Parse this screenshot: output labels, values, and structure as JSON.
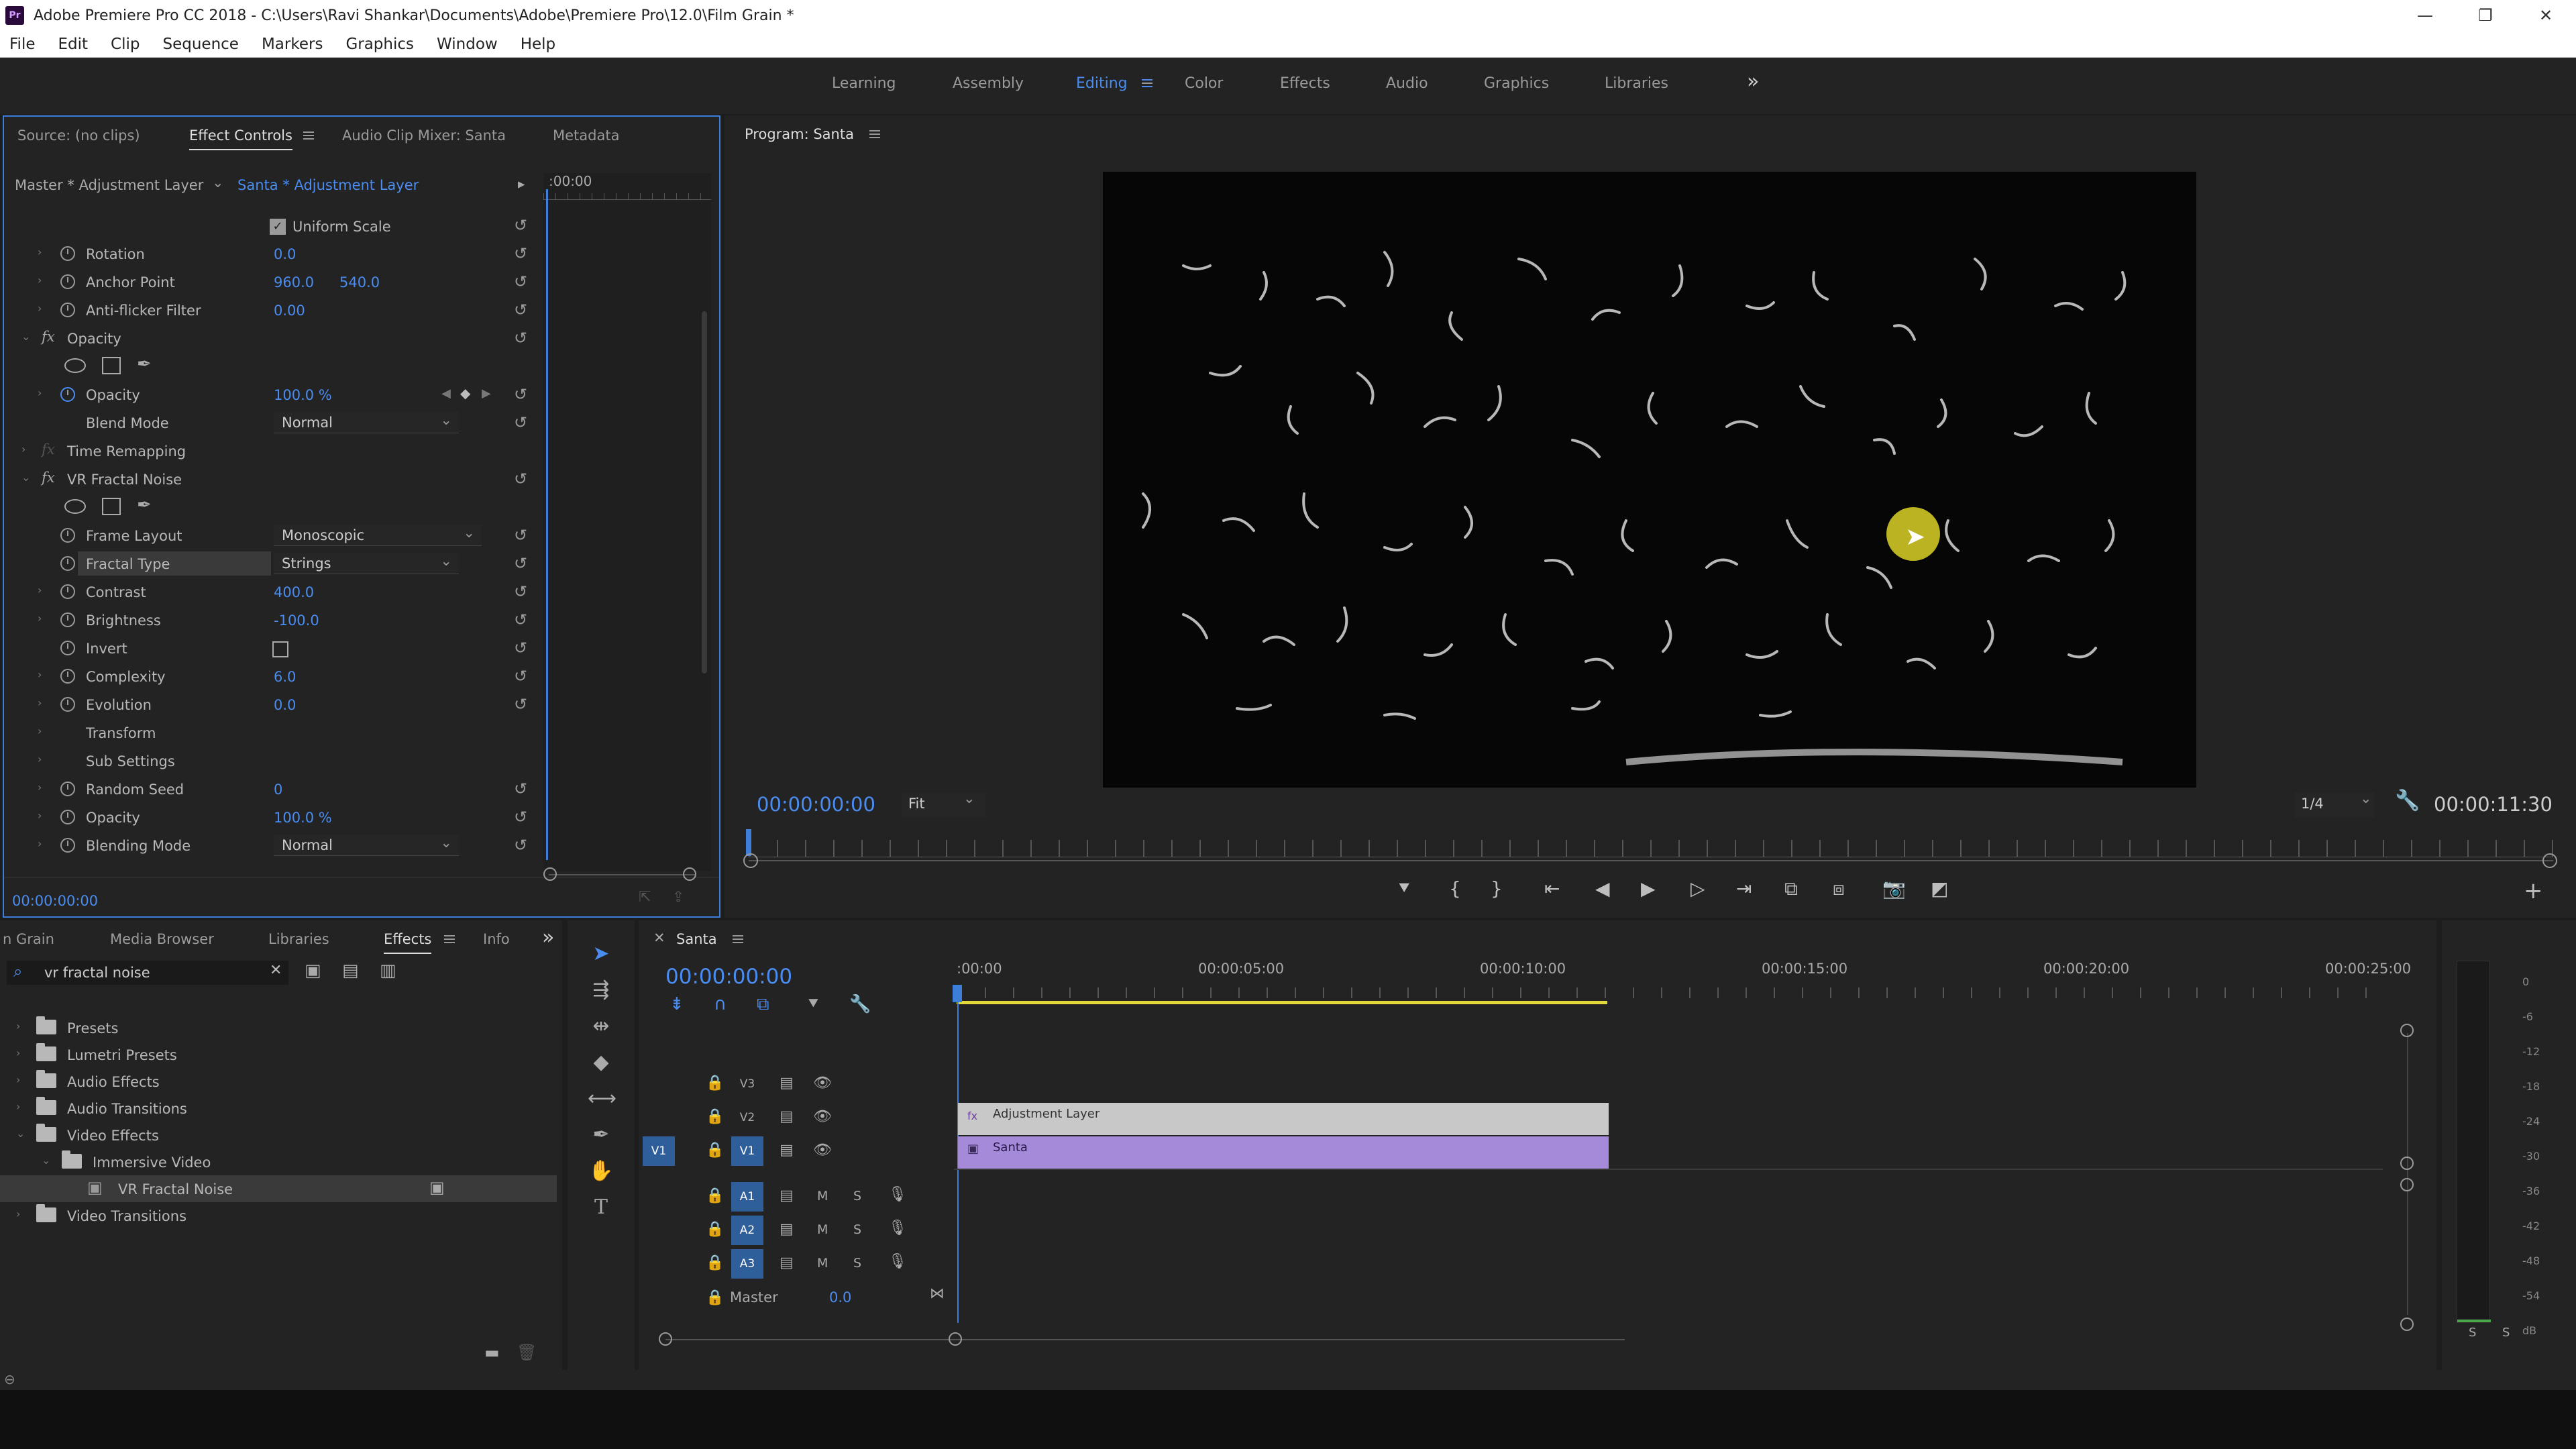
{
  "window": {
    "title": "Adobe Premiere Pro CC 2018 - C:\\Users\\Ravi Shankar\\Documents\\Adobe\\Premiere Pro\\12.0\\Film Grain *",
    "app_badge": "Pr"
  },
  "window_controls": {
    "minimize": "—",
    "restore": "❐",
    "close": "✕"
  },
  "menu": [
    "File",
    "Edit",
    "Clip",
    "Sequence",
    "Markers",
    "Graphics",
    "Window",
    "Help"
  ],
  "workspaces": [
    "Learning",
    "Assembly",
    "Editing",
    "Color",
    "Effects",
    "Audio",
    "Graphics",
    "Libraries"
  ],
  "workspaces_overflow": "»",
  "effect_panel": {
    "tabs": {
      "source": "Source: (no clips)",
      "effect_controls": "Effect Controls",
      "audio_mixer": "Audio Clip Mixer: Santa",
      "metadata": "Metadata"
    },
    "master_label": "Master * Adjustment Layer",
    "clip_label": "Santa * Adjustment Layer",
    "ruler_time": ":00:00",
    "uniform_scale": "Uniform Scale",
    "motion_rows": [
      {
        "label": "Rotation",
        "v1": "0.0"
      },
      {
        "label": "Anchor Point",
        "v1": "960.0",
        "v2": "540.0"
      },
      {
        "label": "Anti-flicker Filter",
        "v1": "0.00"
      }
    ],
    "opacity_header": "Opacity",
    "opacity_value": "100.0 %",
    "opacity_label": "Opacity",
    "blend_mode_label": "Blend Mode",
    "blend_mode_value": "Normal",
    "time_remap": "Time Remapping",
    "vr_header": "VR Fractal Noise",
    "frame_layout_label": "Frame Layout",
    "frame_layout_value": "Monoscopic",
    "fractal_type_label": "Fractal Type",
    "fractal_type_value": "Strings",
    "vr_rows": [
      {
        "label": "Contrast",
        "v1": "400.0"
      },
      {
        "label": "Brightness",
        "v1": "-100.0"
      }
    ],
    "invert_label": "Invert",
    "vr_rows2": [
      {
        "label": "Complexity",
        "v1": "6.0"
      },
      {
        "label": "Evolution",
        "v1": "0.0"
      }
    ],
    "transform": "Transform",
    "sub_settings": "Sub Settings",
    "vr_rows3": [
      {
        "label": "Random Seed",
        "v1": "0"
      },
      {
        "label": "Opacity",
        "v1": "100.0 %"
      }
    ],
    "blending_mode_label": "Blending Mode",
    "blending_mode_value": "Normal",
    "footer_time": "00:00:00:00"
  },
  "program": {
    "title": "Program: Santa",
    "timecode": "00:00:00:00",
    "fit": "Fit",
    "resolution": "1/4",
    "duration": "00:00:11:30"
  },
  "project": {
    "tabs": [
      "n Grain",
      "Media Browser",
      "Libraries",
      "Effects",
      "Info"
    ],
    "tabs_overflow": "»",
    "search_value": "vr fractal noise",
    "items": [
      {
        "label": "Presets"
      },
      {
        "label": "Lumetri Presets"
      },
      {
        "label": "Audio Effects"
      },
      {
        "label": "Audio Transitions"
      },
      {
        "label": "Video Effects"
      },
      {
        "label": "Immersive Video"
      },
      {
        "label": "VR Fractal Noise"
      },
      {
        "label": "Video Transitions"
      }
    ]
  },
  "timeline": {
    "tab": "Santa",
    "timecode": "00:00:00:00",
    "ruler": [
      ":00:00",
      "00:00:05:00",
      "00:00:10:00",
      "00:00:15:00",
      "00:00:20:00",
      "00:00:25:00"
    ],
    "video_tracks": [
      "V3",
      "V2",
      "V1"
    ],
    "audio_tracks": [
      "A1",
      "A2",
      "A3"
    ],
    "source_patch": "V1",
    "mute": "M",
    "solo": "S",
    "master_label": "Master",
    "master_value": "0.0",
    "clip_adjustment": "Adjustment Layer",
    "clip_santa": "Santa",
    "clip_duration_seconds": 11.5
  },
  "meter": {
    "ticks": [
      "0",
      "-6",
      "-12",
      "-18",
      "-24",
      "-30",
      "-36",
      "-42",
      "-48",
      "-54",
      "dB"
    ],
    "solo": [
      "S",
      "S"
    ]
  }
}
